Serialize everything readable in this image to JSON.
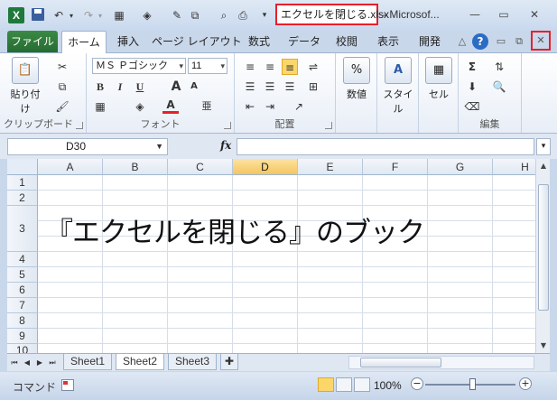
{
  "title": {
    "file": "エクセルを閉じる.xlsx",
    "separator": "-",
    "app": "Microsof..."
  },
  "tabs": {
    "file": "ファイル",
    "items": [
      "ホーム",
      "挿入",
      "ページ レイアウト",
      "数式",
      "データ",
      "校閲",
      "表示",
      "開発"
    ],
    "active_index": 0
  },
  "ribbon": {
    "clipboard": {
      "label": "クリップボード",
      "paste": "貼り付け"
    },
    "font": {
      "label": "フォント",
      "name": "ＭＳ Ｐゴシック",
      "size": "11",
      "bold": "B",
      "italic": "I",
      "underline": "U",
      "grow": "A",
      "shrink": "A",
      "color_letter": "A",
      "phonetic": "亜"
    },
    "alignment": {
      "label": "配置"
    },
    "number": {
      "label": "数値",
      "percent": "%"
    },
    "styles": {
      "label": "スタイル",
      "icon_letter": "A"
    },
    "cells": {
      "label": "セル"
    },
    "editing": {
      "label": "編集",
      "sum": "Σ"
    }
  },
  "formula_bar": {
    "name_box": "D30",
    "fx": "fx",
    "content": ""
  },
  "grid": {
    "columns": [
      "A",
      "B",
      "C",
      "D",
      "E",
      "F",
      "G",
      "H"
    ],
    "selected_column": "D",
    "rows": [
      "1",
      "2",
      "3",
      "4",
      "5",
      "6",
      "7",
      "8",
      "9",
      "10"
    ],
    "cell_a3": "『エクセルを閉じる』のブック"
  },
  "sheets": {
    "tabs": [
      "Sheet1",
      "Sheet2",
      "Sheet3"
    ],
    "active_index": 1
  },
  "status": {
    "mode": "コマンド",
    "zoom": "100%",
    "zoom_minus": "−",
    "zoom_plus": "+"
  },
  "colors": {
    "file_tab": "#2f7d3c",
    "highlight": "#e8202a",
    "selected_header": "#f7c95f"
  }
}
